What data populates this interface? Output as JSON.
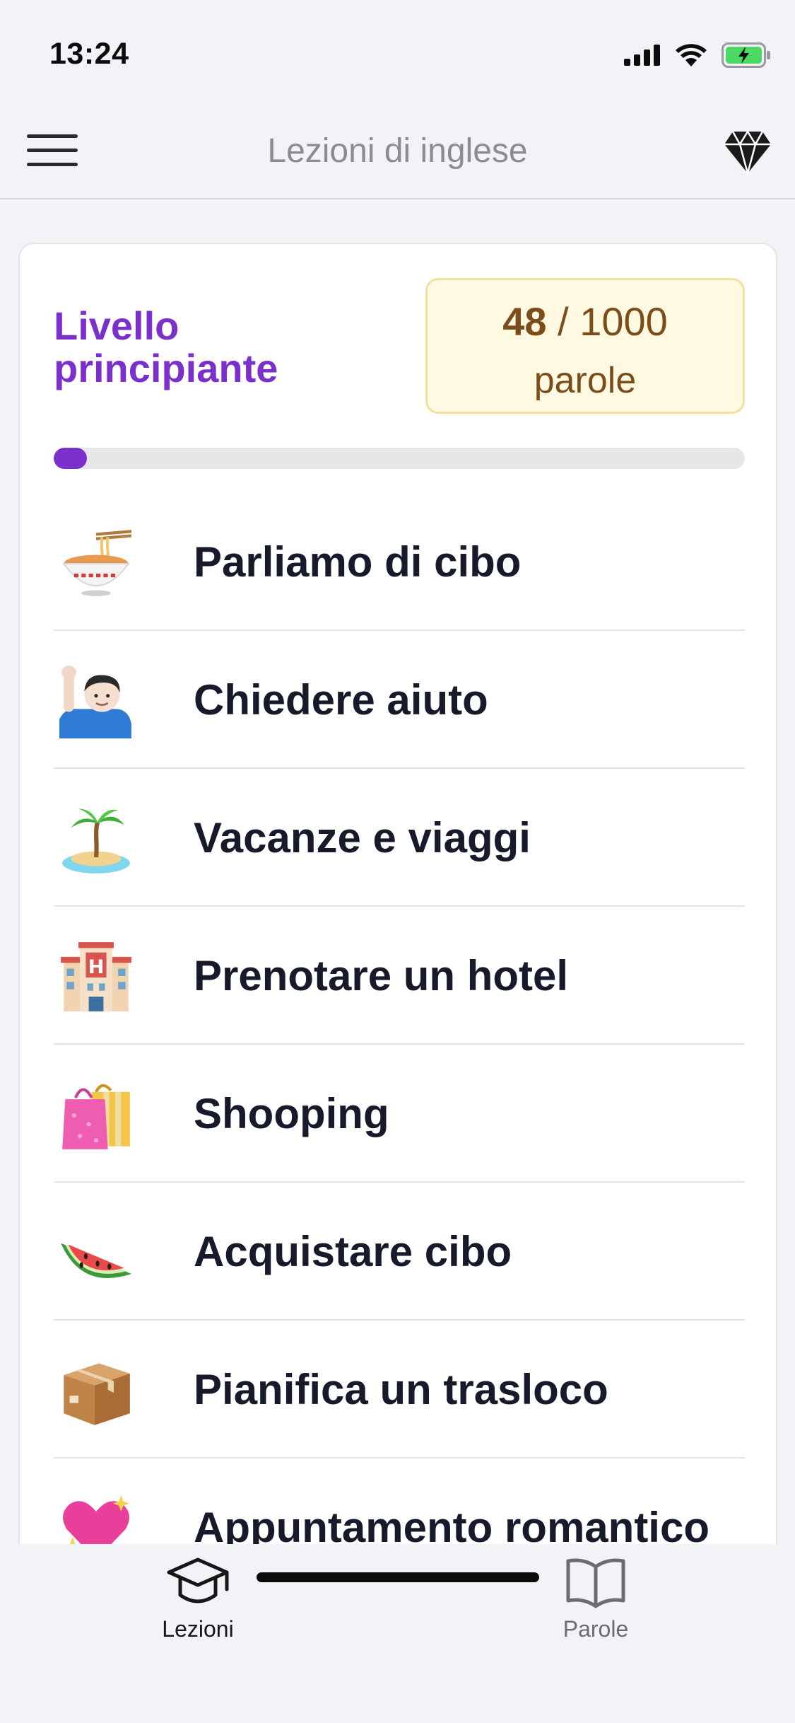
{
  "status_bar": {
    "time": "13:24",
    "icons": [
      "cellular-signal-icon",
      "wifi-icon",
      "battery-charging-icon"
    ]
  },
  "nav": {
    "title": "Lezioni di inglese",
    "left_icon": "hamburger-menu-icon",
    "right_icon": "diamond-icon"
  },
  "level": {
    "title": "Livello principiante",
    "words_learned": "48",
    "words_total": "/ 1000",
    "words_label": "parole",
    "progress_fraction": 0.048
  },
  "lessons": [
    {
      "label": "Parliamo di cibo",
      "icon": "noodle-bowl-icon"
    },
    {
      "label": "Chiedere aiuto",
      "icon": "person-raising-hand-icon"
    },
    {
      "label": "Vacanze e viaggi",
      "icon": "desert-island-icon"
    },
    {
      "label": "Prenotare un hotel",
      "icon": "hotel-icon"
    },
    {
      "label": "Shooping",
      "icon": "shopping-bags-icon"
    },
    {
      "label": "Acquistare cibo",
      "icon": "watermelon-icon"
    },
    {
      "label": "Pianifica un trasloco",
      "icon": "package-icon"
    },
    {
      "label": "Appuntamento romantico",
      "icon": "sparkling-heart-icon"
    }
  ],
  "tabs": [
    {
      "label": "Lezioni",
      "icon": "graduation-cap-icon",
      "active": true
    },
    {
      "label": "Parole",
      "icon": "open-book-icon",
      "active": false
    }
  ],
  "colors": {
    "accent": "#7b2fcb",
    "background": "#f2f3f7",
    "words_box_bg": "#fff9e2",
    "words_box_text": "#7a4d1b",
    "tab_active": "#161616",
    "tab_inactive": "#6b6b70"
  }
}
